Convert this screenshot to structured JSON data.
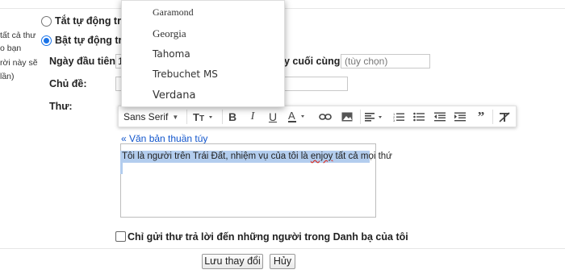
{
  "sidebar_fragments": [
    "tất cả thư",
    "o bạn",
    "rời này sẽ",
    "lần)"
  ],
  "options": {
    "off_label": "Tắt tự động trả l",
    "on_label": "Bật tự động trả l"
  },
  "form": {
    "first_day_label": "Ngày đầu tiên:",
    "first_day_value": "1",
    "last_day_label": "ày cuối cùng:",
    "last_day_placeholder": "(tùy chọn)",
    "subject_label": "Chủ đề:",
    "message_label": "Thư:"
  },
  "font_menu": {
    "items": [
      "Garamond",
      "Georgia",
      "Tahoma",
      "Trebuchet MS",
      "Verdana"
    ]
  },
  "toolbar": {
    "font_name": "Sans Serif",
    "icons": [
      "text-size-icon",
      "bold-icon",
      "italic-icon",
      "underline-icon",
      "text-color-icon",
      "link-icon",
      "image-icon",
      "align-icon",
      "numbered-list-icon",
      "bulleted-list-icon",
      "indent-less-icon",
      "indent-more-icon",
      "quote-icon",
      "remove-formatting-icon"
    ]
  },
  "editor": {
    "plain_text_link": "« Văn bản thuần túy",
    "body_before": "Tôi là người trên Trái Đất, nhiệm vụ của tôi là ",
    "body_misspelled": "enjoy",
    "body_after": " tất cả mọi thứ"
  },
  "contacts_only_label": "Chỉ gửi thư trả lời đến những người trong Danh bạ của tôi",
  "buttons": {
    "save": "Lưu thay đổi",
    "cancel": "Hủy"
  }
}
